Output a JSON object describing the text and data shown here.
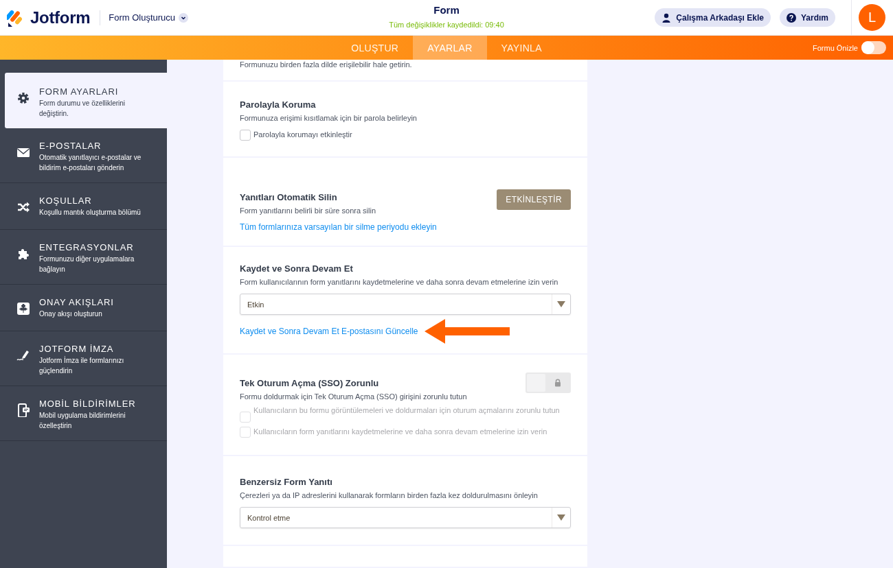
{
  "header": {
    "brand": "Jotform",
    "builder": "Form Oluşturucu",
    "title": "Form",
    "save_status": "Tüm değişiklikler kaydedildi: 09:40",
    "buttons": [
      "Çalışma Arkadaşı Ekle",
      "Yardım"
    ],
    "avatar": "L"
  },
  "tabs": [
    {
      "label": "OLUŞTUR",
      "selected": false
    },
    {
      "label": "AYARLAR",
      "selected": true
    },
    {
      "label": "YAYINLA",
      "selected": false
    }
  ],
  "preview": {
    "label": "Formu Önizle",
    "on": false
  },
  "sidebar": {
    "items": [
      {
        "title": "FORM AYARLARI",
        "description": "Form durumu ve özelliklerini değiştirin.",
        "selected": true
      },
      {
        "title": "E-POSTALAR",
        "description": "Otomatik yanıtlayıcı e-postalar ve bildirim e-postaları gönderin",
        "selected": false
      },
      {
        "title": "KOŞULLAR",
        "description": "Koşullu mantık oluşturma bölümü",
        "selected": false
      },
      {
        "title": "ENTEGRASYONLAR",
        "description": "Formunuzu diğer uygulamalara bağlayın",
        "selected": false
      },
      {
        "title": "ONAY AKIŞLARI",
        "description": "Onay akışı oluşturun",
        "selected": false
      },
      {
        "title": "JOTFORM İMZA",
        "description": "Jotform İmza ile formlarınızı güçlendirin",
        "selected": false
      },
      {
        "title": "MOBİL BİLDİRİMLER",
        "description": "Mobil uygulama bildirimlerini özelleştirin",
        "selected": false
      }
    ]
  },
  "settings": [
    {
      "description": "Formunuzu birden fazla dilde erişilebilir hale getirin."
    },
    {
      "title": "Parolayla Koruma",
      "description": "Formunuza erişimi kısıtlamak için bir parola belirleyin",
      "checkboxes": [
        {
          "label": "Parolayla korumayı etkinleştir",
          "checked": false,
          "disabled": false
        }
      ]
    },
    {
      "title": "Yanıtları Otomatik Silin",
      "description": "Form yanıtlarını belirli bir süre sonra silin",
      "button": "ETKİNLEŞTİR",
      "link": "Tüm formlarınıza varsayılan bir silme periyodu ekleyin"
    },
    {
      "title": "Kaydet ve Sonra Devam Et",
      "description": "Form kullanıcılarının form yanıtlarını kaydetmelerine ve daha sonra devam etmelerine izin verin",
      "select": "Etkin",
      "link": "Kaydet ve Sonra Devam Et E-postasını Güncelle",
      "highlighted": true
    },
    {
      "title": "Tek Oturum Açma (SSO) Zorunlu",
      "description": "Formu doldurmak için Tek Oturum Açma (SSO) girişini zorunlu tutun",
      "toggle": {
        "on": false
      },
      "checkboxes": [
        {
          "label": "Kullanıcıların bu formu görüntülemeleri ve doldurmaları için oturum açmalarını zorunlu tutun",
          "checked": false,
          "disabled": true
        },
        {
          "label": "Kullanıcıların form yanıtlarını kaydetmelerine ve daha sonra devam etmelerine izin verin",
          "checked": false,
          "disabled": true
        }
      ]
    },
    {
      "title": "Benzersiz Form Yanıtı",
      "description": "Çerezleri ya da IP adreslerini kullanarak formların birden fazla kez doldurulmasını önleyin",
      "select": "Kontrol etme"
    }
  ]
}
